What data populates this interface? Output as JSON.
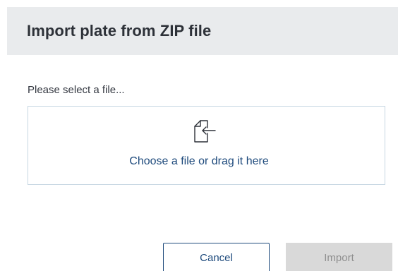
{
  "dialog": {
    "title": "Import plate from ZIP file",
    "select_label": "Please select a file...",
    "dropzone": {
      "icon": "file-import-icon",
      "text": "Choose a file or drag it here"
    },
    "buttons": {
      "cancel_label": "Cancel",
      "import_label": "Import",
      "import_enabled": false
    }
  },
  "colors": {
    "header_bg": "#e9ebed",
    "title_text": "#2d3138",
    "accent": "#1e4a7c",
    "dropzone_border": "#c6d6e2",
    "disabled_bg": "#d9d9d9",
    "disabled_text": "#8f8f8f"
  }
}
